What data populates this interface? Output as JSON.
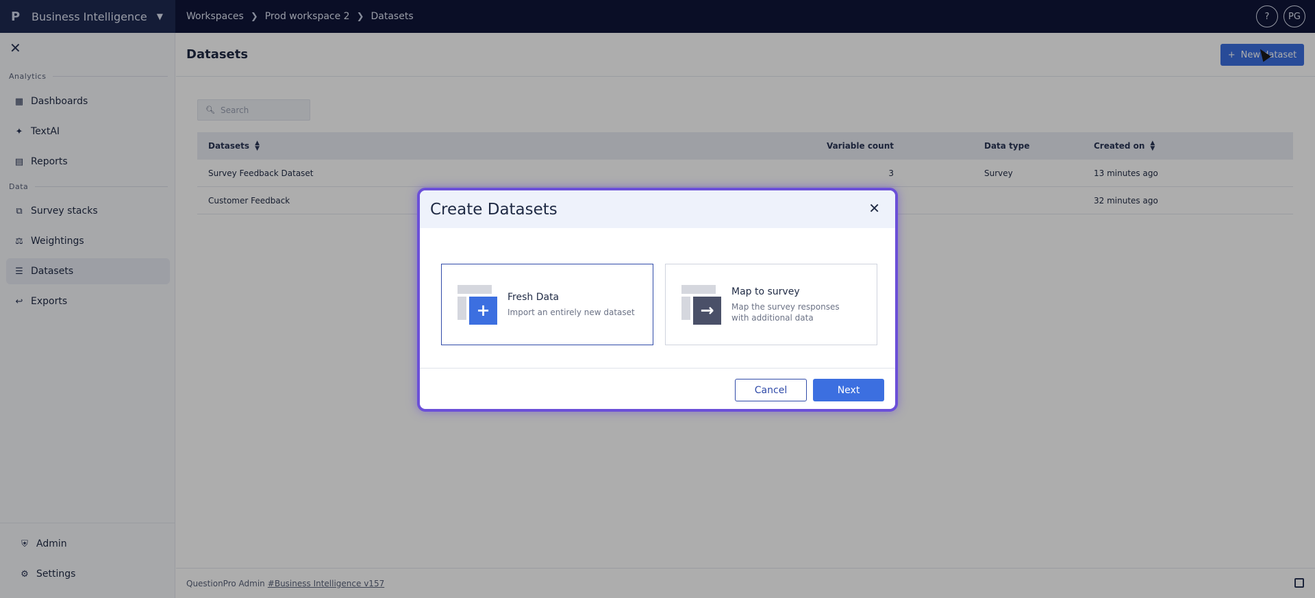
{
  "topbar": {
    "brand_logo": "P",
    "brand_name": "Business Intelligence",
    "breadcrumbs": [
      "Workspaces",
      "Prod workspace 2",
      "Datasets"
    ],
    "help_label": "?",
    "user_initials": "PG"
  },
  "sidebar": {
    "sections": {
      "analytics": "Analytics",
      "data": "Data"
    },
    "items": {
      "dashboards": "Dashboards",
      "textai": "TextAI",
      "reports": "Reports",
      "survey_stacks": "Survey stacks",
      "weightings": "Weightings",
      "datasets": "Datasets",
      "exports": "Exports",
      "admin": "Admin",
      "settings": "Settings"
    }
  },
  "page": {
    "title": "Datasets",
    "new_button": "New dataset",
    "search_placeholder": "Search"
  },
  "table": {
    "columns": [
      "Datasets",
      "Variable count",
      "Data type",
      "Created on"
    ],
    "rows": [
      {
        "name": "Survey Feedback Dataset",
        "count": "3",
        "type": "Survey",
        "created": "13 minutes ago"
      },
      {
        "name": "Customer Feedback",
        "count": "",
        "type": "",
        "created": "32 minutes ago"
      }
    ]
  },
  "footer": {
    "prefix": "QuestionPro Admin",
    "link": "#Business Intelligence v157"
  },
  "modal": {
    "title": "Create Datasets",
    "options": [
      {
        "title": "Fresh Data",
        "desc": "Import an entirely new dataset"
      },
      {
        "title": "Map to survey",
        "desc": "Map the survey responses with additional data"
      }
    ],
    "cancel": "Cancel",
    "next": "Next"
  },
  "colors": {
    "topbar": "#0f1638",
    "brand_bg": "#1e2a52",
    "accent": "#3c6fe0",
    "modal_border": "#6b4fd8"
  }
}
